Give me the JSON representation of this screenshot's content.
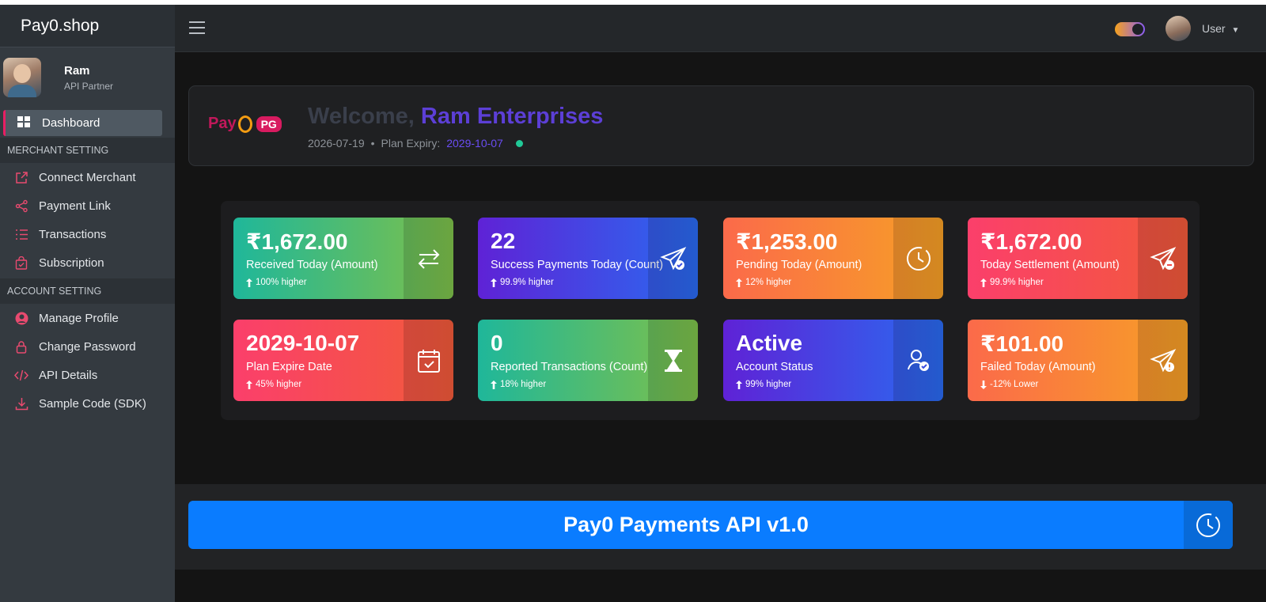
{
  "app": {
    "brand": "Pay0.shop"
  },
  "sidebar": {
    "profile": {
      "name": "Ram",
      "role": "API Partner"
    },
    "active_item": "Dashboard",
    "sections": [
      {
        "title": "MERCHANT SETTING",
        "items": [
          "Connect Merchant",
          "Payment Link",
          "Transactions",
          "Subscription"
        ]
      },
      {
        "title": "ACCOUNT SETTING",
        "items": [
          "Manage Profile",
          "Change Password",
          "API Details",
          "Sample Code (SDK)"
        ]
      }
    ]
  },
  "topbar": {
    "user_label": "User",
    "theme_toggle": "dark"
  },
  "welcome": {
    "logo_text": "Pay",
    "logo_badge": "PG",
    "greeting": "Welcome, ",
    "company": "Ram Enterprises",
    "date": "2026-07-19",
    "separator": "•",
    "plan_expiry_label": "Plan Expiry:",
    "plan_expiry": "2029-10-07"
  },
  "cards": [
    {
      "value": "₹1,672.00",
      "label": "Received Today (Amount)",
      "trend": "100% higher",
      "direction": "up",
      "icon": "transfer-arrows-icon",
      "color": "green"
    },
    {
      "value": "22",
      "label": "Success Payments Today (Count)",
      "trend": "99.9% higher",
      "direction": "up",
      "icon": "send-check-icon",
      "color": "purple"
    },
    {
      "value": "₹1,253.00",
      "label": "Pending Today (Amount)",
      "trend": "12% higher",
      "direction": "up",
      "icon": "clock-icon",
      "color": "orange"
    },
    {
      "value": "₹1,672.00",
      "label": "Today Settlement (Amount)",
      "trend": "99.9% higher",
      "direction": "up",
      "icon": "send-minus-icon",
      "color": "red"
    },
    {
      "value": "2029-10-07",
      "label": "Plan Expire Date",
      "trend": "45% higher",
      "direction": "up",
      "icon": "calendar-check-icon",
      "color": "red"
    },
    {
      "value": "0",
      "label": "Reported Transactions (Count)",
      "trend": "18% higher",
      "direction": "up",
      "icon": "hourglass-icon",
      "color": "green"
    },
    {
      "value": "Active",
      "label": "Account Status",
      "trend": "99% higher",
      "direction": "up",
      "icon": "user-check-icon",
      "color": "purple"
    },
    {
      "value": "₹101.00",
      "label": "Failed Today (Amount)",
      "trend": "-12% Lower",
      "direction": "down",
      "icon": "send-alert-icon",
      "color": "orange"
    }
  ],
  "api_banner": {
    "title": "Pay0 Payments API v1.0",
    "icon": "clock-icon"
  }
}
